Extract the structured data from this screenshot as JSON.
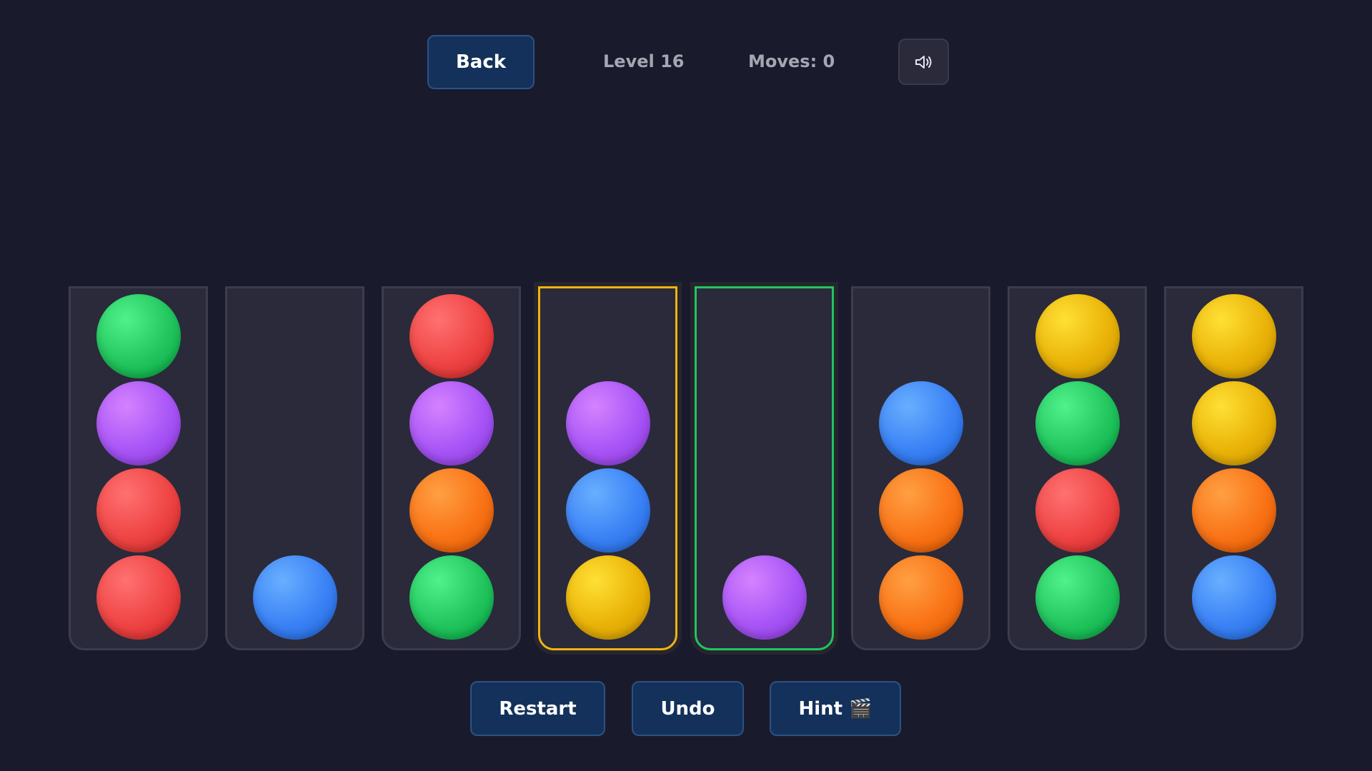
{
  "header": {
    "back_label": "Back",
    "level_label": "Level 16",
    "moves_label": "Moves: 0",
    "sound_icon": "speaker-icon"
  },
  "game": {
    "tube_capacity": 4,
    "colors": {
      "green": "#22c55e",
      "purple": "#a855f7",
      "red": "#ef4444",
      "blue": "#3b82f6",
      "orange": "#f97316",
      "yellow": "#eab308"
    },
    "tubes": [
      {
        "balls": [
          "red",
          "red",
          "purple",
          "green"
        ],
        "state": "normal"
      },
      {
        "balls": [
          "blue"
        ],
        "state": "normal"
      },
      {
        "balls": [
          "green",
          "orange",
          "purple",
          "red"
        ],
        "state": "normal"
      },
      {
        "balls": [
          "yellow",
          "blue",
          "purple"
        ],
        "state": "selected"
      },
      {
        "balls": [
          "purple"
        ],
        "state": "target"
      },
      {
        "balls": [
          "orange",
          "orange",
          "blue"
        ],
        "state": "normal"
      },
      {
        "balls": [
          "green",
          "red",
          "green",
          "yellow"
        ],
        "state": "normal"
      },
      {
        "balls": [
          "blue",
          "orange",
          "yellow",
          "yellow"
        ],
        "state": "normal"
      }
    ],
    "selected_border_color": "#f0b40e",
    "target_border_color": "#22c55e"
  },
  "controls": {
    "restart_label": "Restart",
    "undo_label": "Undo",
    "hint_label": "Hint 🎬"
  }
}
